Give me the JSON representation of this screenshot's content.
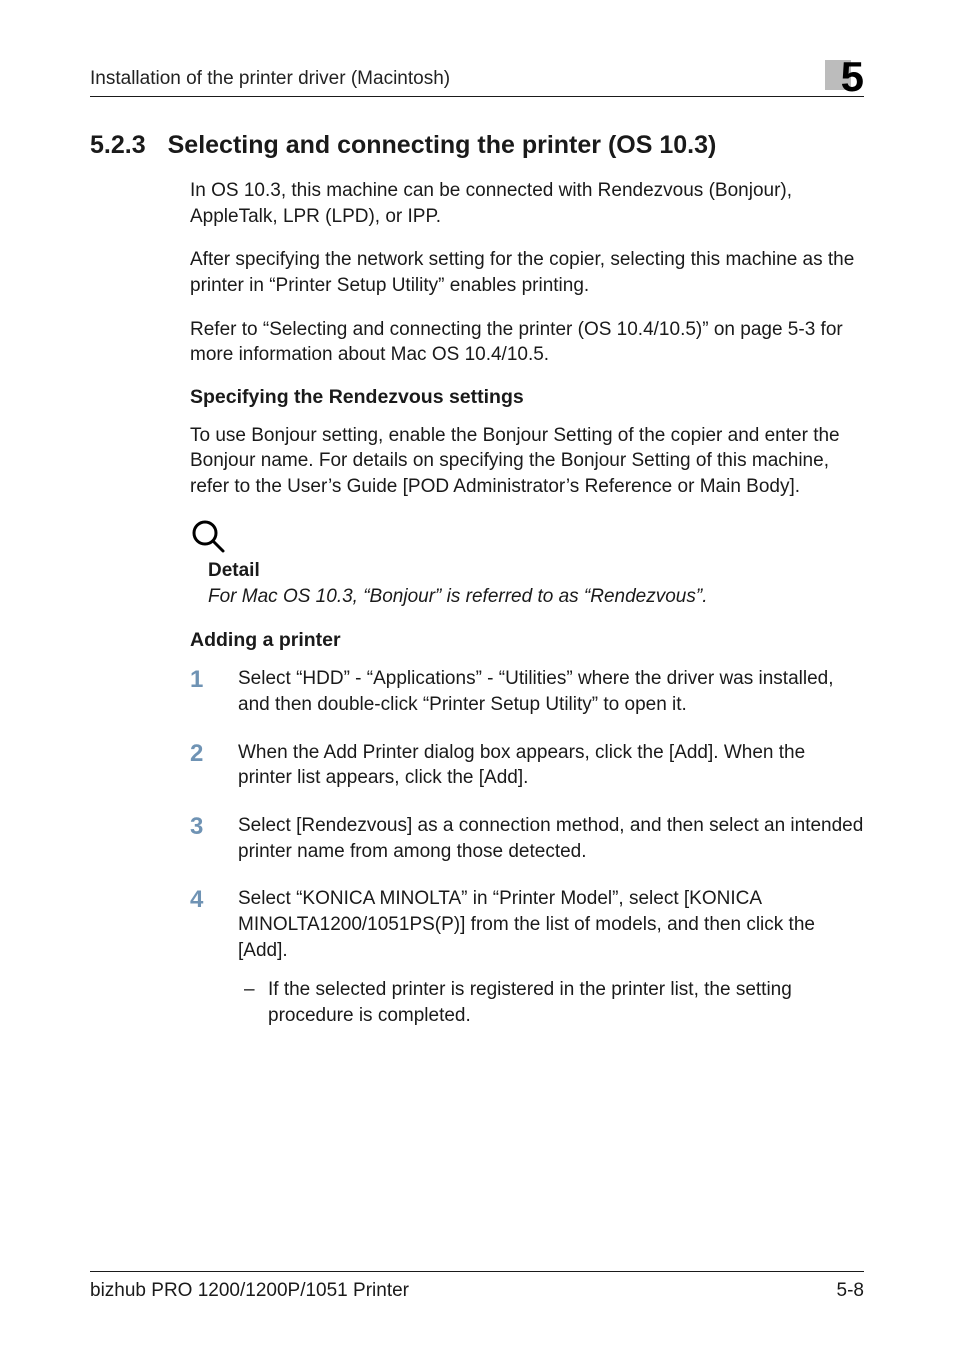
{
  "header": {
    "running_title": "Installation of the printer driver (Macintosh)",
    "chapter_number": "5"
  },
  "section": {
    "number": "5.2.3",
    "title": "Selecting and connecting the printer (OS 10.3)",
    "paragraphs": [
      "In OS 10.3, this machine can be connected with Rendezvous (Bonjour), AppleTalk, LPR (LPD), or IPP.",
      "After specifying the network setting for the copier, selecting this machine as the printer in “Printer Setup Utility” enables printing.",
      "Refer to “Selecting and connecting the printer (OS 10.4/10.5)” on page 5-3 for more information about Mac OS 10.4/10.5."
    ]
  },
  "rendezvous": {
    "heading": "Specifying the Rendezvous settings",
    "paragraph": "To use Bonjour setting, enable the Bonjour Setting of the copier and enter the Bonjour name. For details on specifying the Bonjour Setting of this machine, refer to the User’s Guide [POD Administrator’s Reference or Main Body]."
  },
  "detail": {
    "label": "Detail",
    "text": "For Mac OS 10.3, “Bonjour” is referred to as “Rendezvous”."
  },
  "adding_printer": {
    "heading": "Adding a printer",
    "steps": {
      "s1": {
        "num": "1",
        "text": "Select “HDD” - “Applications” - “Utilities” where the driver was installed, and then double-click “Printer Setup Utility” to open it."
      },
      "s2": {
        "num": "2",
        "text": "When the Add Printer dialog box appears, click the [Add]. When the printer list appears, click the [Add]."
      },
      "s3": {
        "num": "3",
        "text": "Select [Rendezvous] as a connection method, and then select an intended printer name from among those detected."
      },
      "s4": {
        "num": "4",
        "text": "Select “KONICA MINOLTA” in “Printer Model”, select [KONICA MINOLTA1200/1051PS(P)] from the list of models, and then click the [Add].",
        "sub1": "If the selected printer is registered in the printer list, the setting procedure is completed."
      }
    }
  },
  "footer": {
    "product": "bizhub PRO 1200/1200P/1051 Printer",
    "page": "5-8"
  }
}
